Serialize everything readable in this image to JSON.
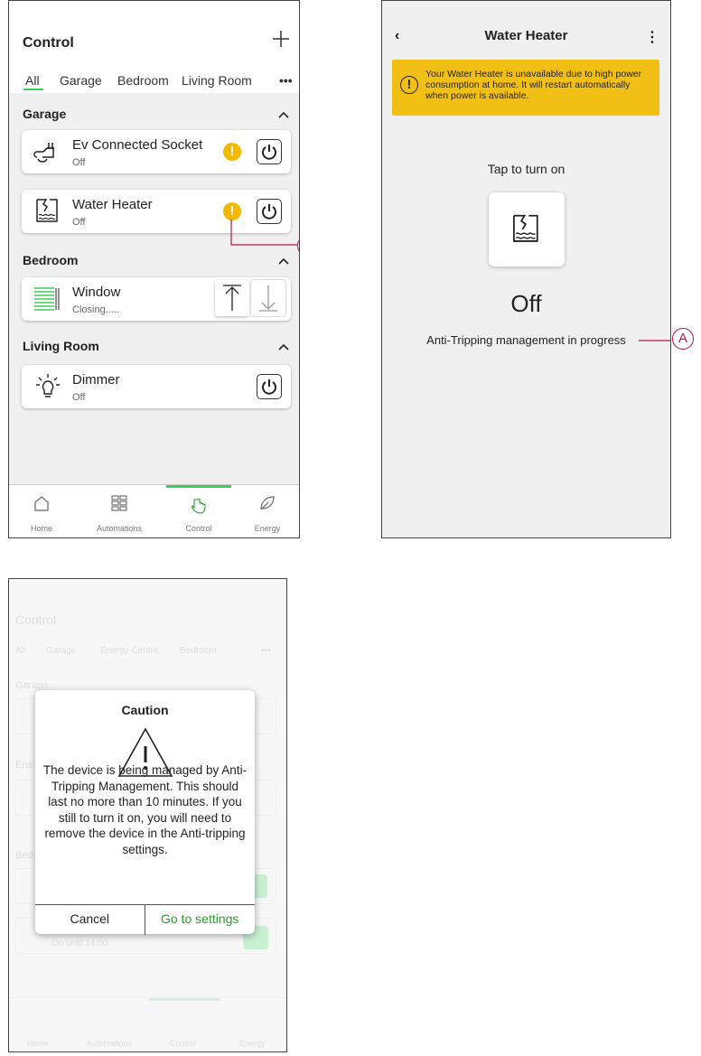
{
  "screen1": {
    "title": "Control",
    "tabs": [
      "All",
      "Garage",
      "Bedroom",
      "Living Room"
    ],
    "more_label": "•••",
    "sections": [
      {
        "name": "Garage"
      },
      {
        "name": "Bedroom"
      },
      {
        "name": "Living Room"
      }
    ],
    "devices": [
      {
        "name": "Ev Connected Socket",
        "status": "Off"
      },
      {
        "name": "Water Heater",
        "status": "Off"
      },
      {
        "name": "Window",
        "status": "Closing....."
      },
      {
        "name": "Dimmer",
        "status": "Off"
      }
    ],
    "nav": [
      {
        "label": "Home"
      },
      {
        "label": "Automations"
      },
      {
        "label": "Control"
      },
      {
        "label": "Energy"
      }
    ],
    "callout": "A"
  },
  "screen2": {
    "title": "Water Heater",
    "banner": "Your Water Heater is unavailable due to high power consumption at home. It will restart automatically when power is available.",
    "tap_label": "Tap to turn on",
    "state": "Off",
    "anti_tripping": "Anti-Tripping management in progress",
    "callout": "A"
  },
  "screen3": {
    "bg_title": "Control",
    "bg_tabs": [
      "All",
      "Garage",
      "Energy Centre",
      "Bedroom"
    ],
    "bg_sections": [
      "Garage",
      "Ene",
      "Bed"
    ],
    "bg_device_status": "On until 14:00",
    "bg_nav": [
      "Home",
      "Automations",
      "Control",
      "Energy"
    ],
    "dialog": {
      "title": "Caution",
      "message": "The device is being managed by Anti-Tripping Management. This should last no more than 10 minutes. If you still to turn it on, you will need to remove the device in the Anti-tripping settings.",
      "cancel": "Cancel",
      "confirm": "Go to settings"
    }
  },
  "colors": {
    "accent": "#3dcd58",
    "warning": "#f5b800",
    "banner": "#f2c014",
    "callout": "#b0184a"
  }
}
